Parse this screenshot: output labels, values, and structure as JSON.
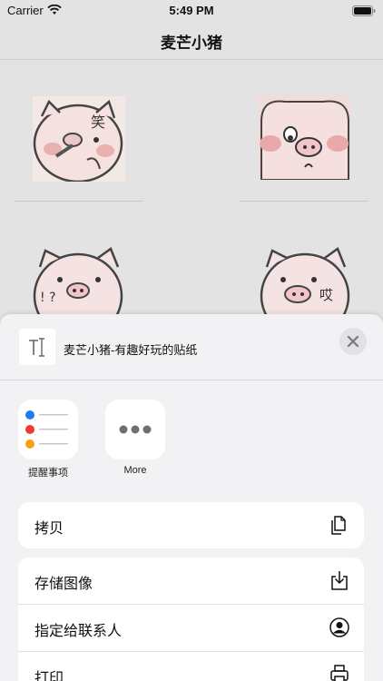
{
  "status_bar": {
    "carrier": "Carrier",
    "time": "5:49 PM"
  },
  "nav": {
    "title": "麦芒小猪"
  },
  "stickers": [
    {
      "name": "pig-pointing",
      "text": "笑"
    },
    {
      "name": "pig-looking-down",
      "text": ""
    },
    {
      "name": "pig-confused",
      "text": "! ?"
    },
    {
      "name": "pig-sighing",
      "text": "哎"
    }
  ],
  "share_sheet": {
    "title": "麦芒小猪-有趣好玩的贴纸",
    "apps": [
      {
        "label": "提醒事项",
        "icon": "reminders-icon"
      },
      {
        "label": "More",
        "icon": "more-icon"
      }
    ],
    "actions": [
      {
        "label": "拷贝",
        "icon": "copy-icon"
      },
      {
        "label": "存储图像",
        "icon": "save-image-icon"
      },
      {
        "label": "指定给联系人",
        "icon": "assign-contact-icon"
      },
      {
        "label": "打印",
        "icon": "print-icon"
      }
    ]
  }
}
